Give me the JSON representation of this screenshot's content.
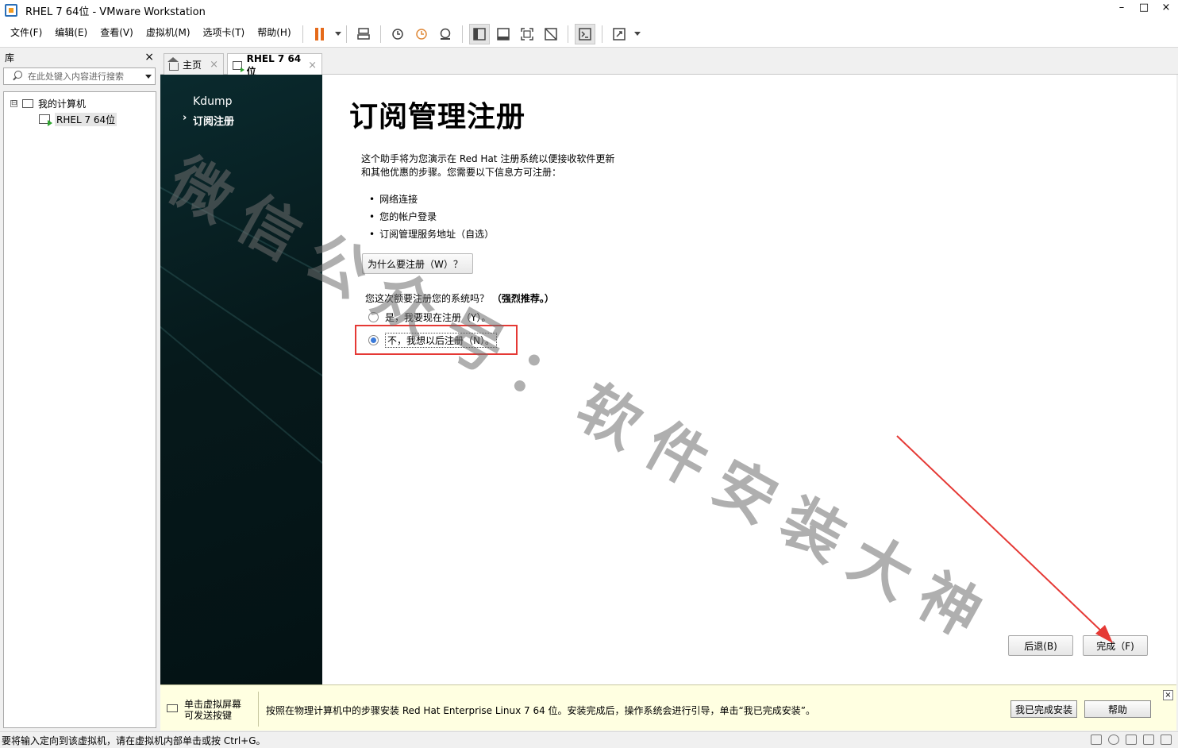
{
  "window": {
    "title": "RHEL 7 64位 - VMware Workstation",
    "controls": {
      "minimize": "–",
      "maximize": "□",
      "close": "×"
    }
  },
  "menu": [
    "文件(F)",
    "编辑(E)",
    "查看(V)",
    "虚拟机(M)",
    "选项卡(T)",
    "帮助(H)"
  ],
  "library": {
    "title": "库",
    "close": "×",
    "search_placeholder": "在此处键入内容进行搜索",
    "tree": {
      "root": "我的计算机",
      "expander": "⊟",
      "vm": "RHEL 7 64位"
    }
  },
  "tabs": [
    {
      "label": "主页",
      "close": "×"
    },
    {
      "label": "RHEL 7 64位",
      "close": "×"
    }
  ],
  "installer": {
    "sidebar": [
      "Kdump",
      "订阅注册"
    ],
    "title": "订阅管理注册",
    "intro_line1": "这个助手将为您演示在 Red Hat 注册系统以便接收软件更新",
    "intro_line2": "和其他优惠的步骤。您需要以下信息方可注册：",
    "bullets": [
      "网络连接",
      "您的帐户登录",
      "订阅管理服务地址（自选）"
    ],
    "why_button": "为什么要注册（W）？",
    "question": "您这次额要注册您的系统吗？",
    "question_emph": "（强烈推荐。）",
    "option_yes": "是，我要现在注册（Y）。",
    "option_no": "不，我想以后注册（N）。",
    "selected": "no",
    "back_button": "后退(B)",
    "finish_button": "完成（F)"
  },
  "watermark": "微信公众号：软件安装大神",
  "hint": {
    "left_line1": "单击虚拟屏幕",
    "left_line2": "可发送按键",
    "message": "按照在物理计算机中的步骤安装 Red Hat Enterprise Linux 7 64 位。安装完成后，操作系统会进行引导，单击“我已完成安装”。",
    "done_button": "我已完成安装",
    "help_button": "帮助",
    "close": "×"
  },
  "status": {
    "message": "要将输入定向到该虚拟机，请在虚拟机内部单击或按 Ctrl+G。"
  },
  "colors": {
    "accent_pause": "#e56a1a",
    "highlight_box": "#e53935",
    "sidebar_bg": "#06191b"
  }
}
